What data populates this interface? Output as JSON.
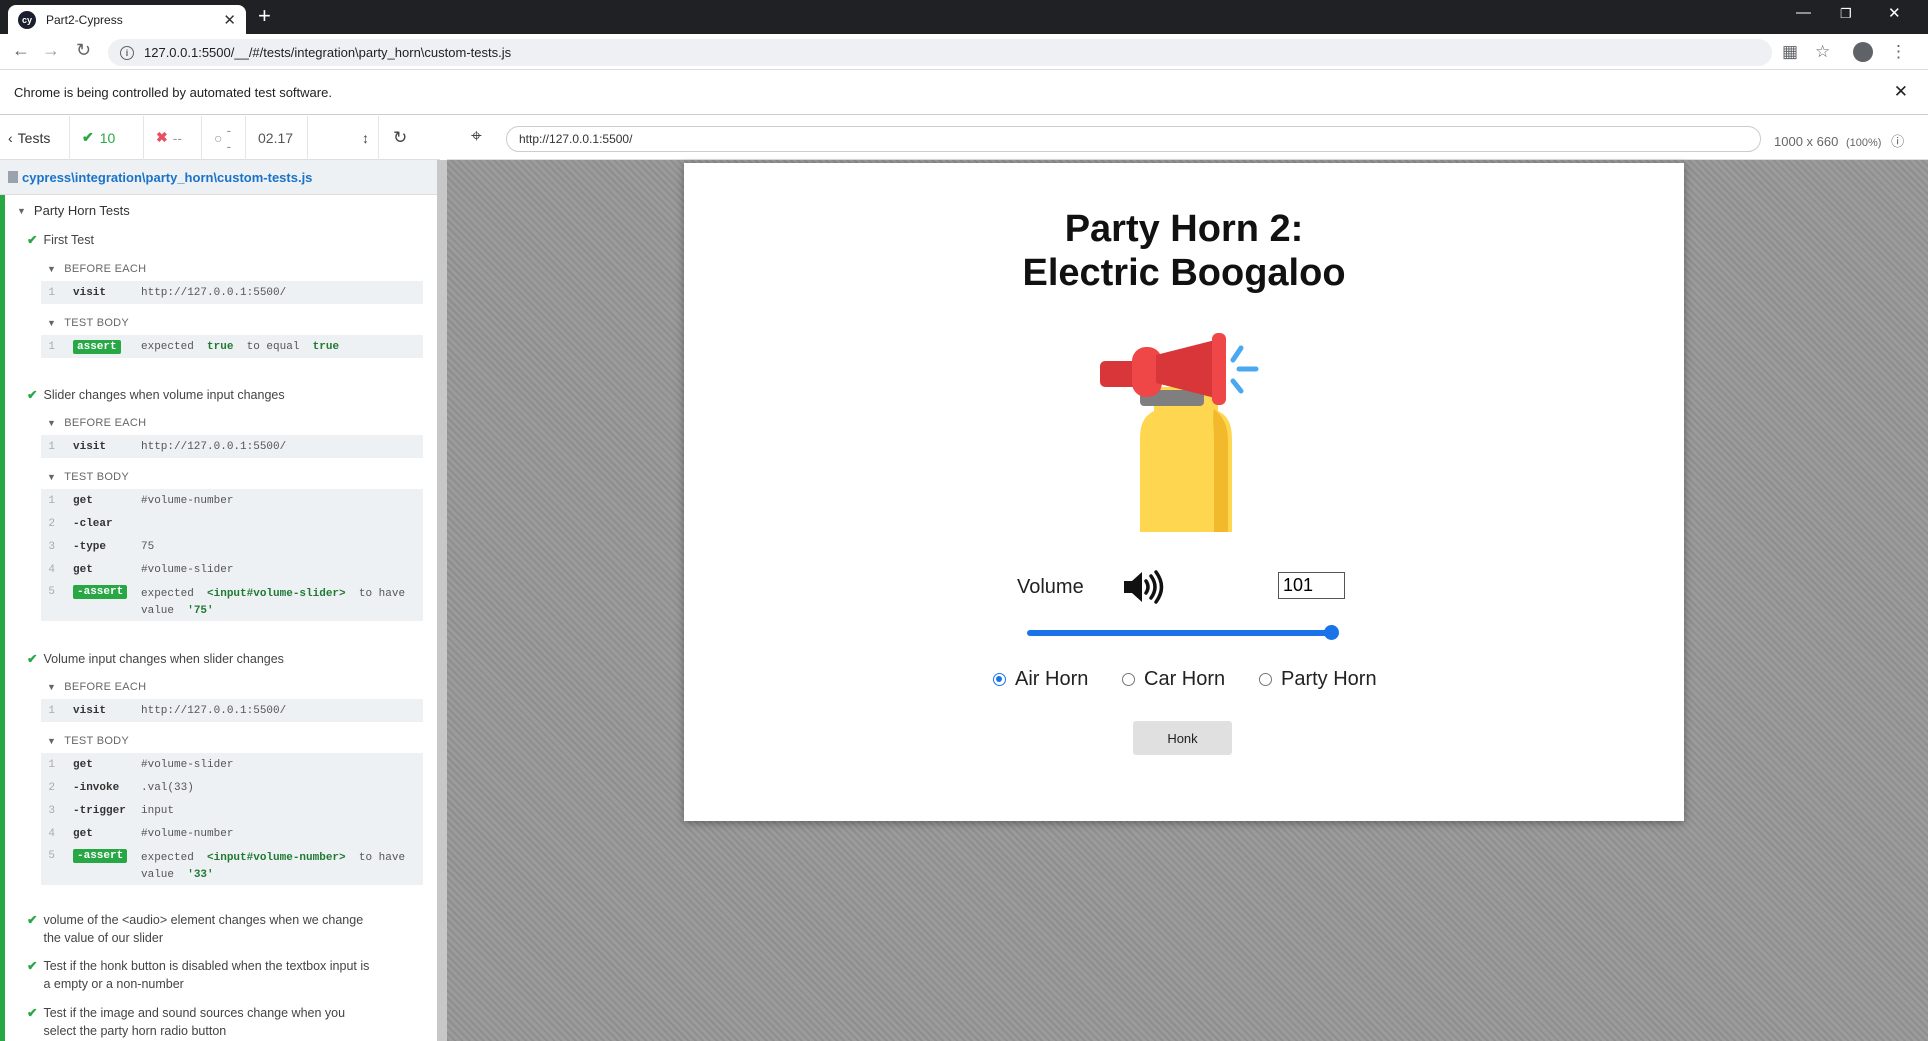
{
  "browser": {
    "tab_title": "Part2-Cypress",
    "url": "127.0.0.1:5500/__/#/tests/integration\\party_horn\\custom-tests.js",
    "infobar": "Chrome is being controlled by automated test software."
  },
  "cypress": {
    "back_label": "Tests",
    "passed": "10",
    "failed": "--",
    "pending": "--",
    "duration": "02.17",
    "spec_path": "cypress\\integration\\party_horn\\custom-tests.js",
    "aut_url": "http://127.0.0.1:5500/",
    "viewport": "1000 x 660",
    "viewport_scale": "(100%)"
  },
  "reporter": {
    "suite": "Party Horn Tests",
    "hooks": {
      "before_each": "BEFORE EACH",
      "test_body": "TEST BODY"
    },
    "tests": [
      {
        "title": "First Test",
        "before": [
          {
            "n": "1",
            "name": "visit",
            "msg": "http://127.0.0.1:5500/"
          }
        ],
        "body": [
          {
            "n": "1",
            "name": "assert",
            "msg_a": "expected",
            "msg_b": "true",
            "msg_c": "to equal",
            "msg_d": "true"
          }
        ]
      },
      {
        "title": "Slider changes when volume input changes",
        "before": [
          {
            "n": "1",
            "name": "visit",
            "msg": "http://127.0.0.1:5500/"
          }
        ],
        "body": [
          {
            "n": "1",
            "name": "get",
            "msg": "#volume-number"
          },
          {
            "n": "2",
            "name": "-clear",
            "msg": ""
          },
          {
            "n": "3",
            "name": "-type",
            "msg": "75"
          },
          {
            "n": "4",
            "name": "get",
            "msg": "#volume-slider"
          },
          {
            "n": "5",
            "name": "-assert",
            "msg_a": "expected",
            "msg_b": "<input#volume-slider>",
            "msg_c": "to have",
            "msg_e": "value",
            "msg_f": "'75'"
          }
        ]
      },
      {
        "title": "Volume input changes when slider changes",
        "before": [
          {
            "n": "1",
            "name": "visit",
            "msg": "http://127.0.0.1:5500/"
          }
        ],
        "body": [
          {
            "n": "1",
            "name": "get",
            "msg": "#volume-slider"
          },
          {
            "n": "2",
            "name": "-invoke",
            "msg": ".val(33)"
          },
          {
            "n": "3",
            "name": "-trigger",
            "msg": "input"
          },
          {
            "n": "4",
            "name": "get",
            "msg": "#volume-number"
          },
          {
            "n": "5",
            "name": "-assert",
            "msg_a": "expected",
            "msg_b": "<input#volume-number>",
            "msg_c": "to have",
            "msg_e": "value",
            "msg_f": "'33'"
          }
        ]
      }
    ],
    "collapsed": [
      {
        "l1": "volume of the <audio> element changes when we change",
        "l2": "the value of our slider"
      },
      {
        "l1": "Test if the honk button is disabled when the textbox input is",
        "l2": "a empty or a non-number"
      },
      {
        "l1": "Test if the image and sound sources change when you",
        "l2": "select the party horn radio button"
      }
    ]
  },
  "app": {
    "title_line1": "Party Horn 2:",
    "title_line2": "Electric Boogaloo",
    "volume_label": "Volume",
    "volume_value": "101",
    "volume_slider_level": 100,
    "radios": [
      {
        "label": "Air Horn",
        "checked": true
      },
      {
        "label": "Car Horn",
        "checked": false
      },
      {
        "label": "Party Horn",
        "checked": false
      }
    ],
    "honk_label": "Honk"
  },
  "colors": {
    "pass": "#28a745",
    "fail": "#e94f5f",
    "accent": "#1a73e8",
    "pending_dot": "#f0a020"
  }
}
